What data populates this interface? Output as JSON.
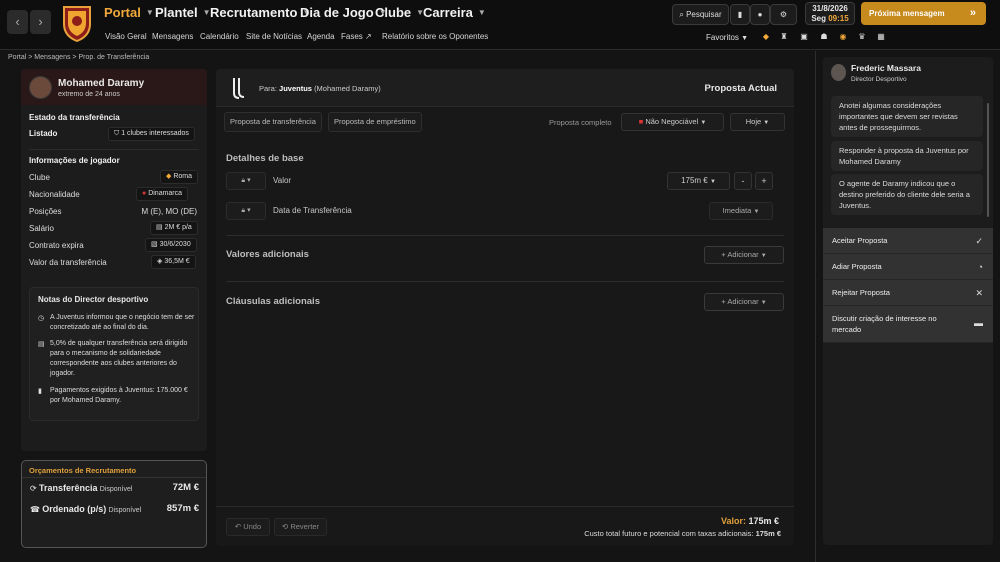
{
  "topbar": {
    "nav": [
      "Portal",
      "Plantel",
      "Recrutamento",
      "Dia de Jogo",
      "Clube",
      "Carreira"
    ],
    "subnav": [
      "Visão Geral",
      "Mensagens",
      "Calendário",
      "Site de Notícias",
      "Agenda",
      "Fases",
      "Relatório sobre os Oponentes"
    ],
    "search_label": "Pesquisar",
    "date": "31/8/2026",
    "weekday": "Seg",
    "time": "09:15",
    "next_label": "Próxima mensagem",
    "favorites_label": "Favoritos"
  },
  "breadcrumb": [
    "Portal",
    "Mensagens",
    "Prop. de Transferência"
  ],
  "player": {
    "name": "Mohamed Daramy",
    "subtitle": "extremo de 24 anos",
    "transfer_status_title": "Estado da transferência",
    "listed": "Listado",
    "clubs_interested": "1 clubes interessados",
    "info_title": "Informações de jogador",
    "info": [
      {
        "label": "Clube",
        "value": "Roma"
      },
      {
        "label": "Nacionalidade",
        "value": "Dinamarca"
      },
      {
        "label": "Posições",
        "value": "M (E), MO (DE)"
      },
      {
        "label": "Salário",
        "value": "2M € p/a"
      },
      {
        "label": "Contrato expira",
        "value": "30/6/2030"
      },
      {
        "label": "Valor da transferência",
        "value": "36,5M €"
      }
    ],
    "notes_title": "Notas do Director desportivo",
    "notes": [
      "A Juventus informou que o negócio tem de ser concretizado até ao final do dia.",
      "5,0% de qualquer transferência será dirigido para o mecanismo de solidariedade correspondente aos clubes anteriores do jogador.",
      "Pagamentos exigidos à Juventus: 175.000 € por Mohamed Daramy."
    ]
  },
  "budget": {
    "title": "Orçamentos de Recrutamento",
    "rows": [
      {
        "label": "Transferência",
        "status": "Disponível",
        "value": "72M €"
      },
      {
        "label": "Ordenado (p/s)",
        "status": "Disponível",
        "value": "857m €"
      }
    ]
  },
  "proposal": {
    "to_label": "Para:",
    "to_club": "Juventus",
    "to_player": "(Mohamed Daramy)",
    "header": "Proposta Actual",
    "tabs": [
      "Proposta de transferência",
      "Proposta de empréstimo"
    ],
    "complete_label": "Proposta completo",
    "negotiable": "Não Negociável",
    "when": "Hoje",
    "base_title": "Detalhes de base",
    "value_label": "Valor",
    "value": "175m €",
    "date_label": "Data de Transferência",
    "date_value": "Imediata",
    "additional_title": "Valores adicionais",
    "clauses_title": "Cláusulas adicionais",
    "add_label": "Adicionar",
    "undo": "Undo",
    "revert": "Reverter",
    "total_label": "Valor:",
    "total_value": "175m €",
    "cost_label": "Custo total futuro e potencial com taxas adicionais:",
    "cost_value": "175m €"
  },
  "director": {
    "name": "Frederic Massara",
    "role": "Director Desportivo",
    "messages": [
      "Anotei algumas considerações importantes que devem ser revistas antes de prosseguirmos.",
      "Responder à proposta da Juventus por Mohamed Daramy",
      "O agente de Daramy indicou que o destino preferido do cliente dele seria a Juventus."
    ],
    "actions": [
      "Aceitar Proposta",
      "Adiar Proposta",
      "Rejeitar Proposta",
      "Discutir criação de interesse no mercado"
    ]
  },
  "colors": {
    "accent": "#f2a93b",
    "next_button": "#c68a1d",
    "budget_title": "#e0a03a"
  }
}
